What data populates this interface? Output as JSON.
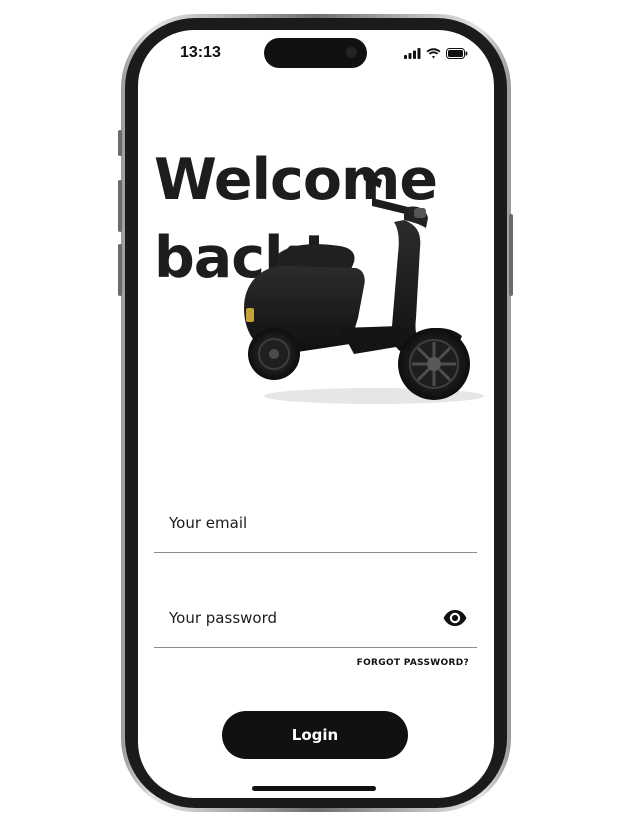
{
  "status_bar": {
    "time": "13:13",
    "icons": [
      "cellular-signal-icon",
      "wifi-icon",
      "battery-icon"
    ]
  },
  "headline": {
    "line1": "Welcome",
    "line2": "back!"
  },
  "hero_image": "electric-scooter",
  "form": {
    "email": {
      "value": "",
      "placeholder": "Your email"
    },
    "password": {
      "value": "",
      "placeholder": "Your password",
      "toggle_icon": "eye-icon"
    },
    "forgot_password_label": "FORGOT PASSWORD?",
    "login_label": "Login"
  },
  "colors": {
    "text": "#1d1d1d",
    "button": "#111111",
    "button_text": "#ffffff",
    "divider": "#8e8e8e"
  }
}
